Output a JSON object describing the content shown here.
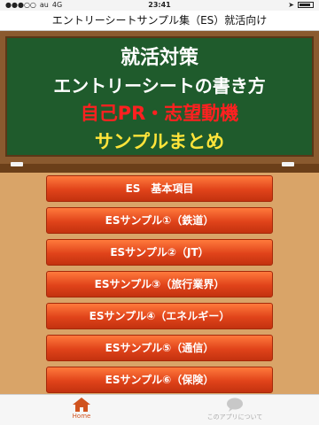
{
  "status": {
    "carrier": "au",
    "network": "4G",
    "time": "23:41"
  },
  "app": {
    "title": "エントリーシートサンプル集（ES）就活向け"
  },
  "board": {
    "line1": "就活対策",
    "line2": "エントリーシートの書き方",
    "line3": "自己PR・志望動機",
    "line4": "サンプルまとめ"
  },
  "menu": {
    "items": [
      "ES　基本項目",
      "ESサンプル①（鉄道）",
      "ESサンプル②（JT）",
      "ESサンプル③（旅行業界）",
      "ESサンプル④（エネルギー）",
      "ESサンプル⑤（通信）",
      "ESサンプル⑥（保険）"
    ]
  },
  "tabbar": {
    "home": "Home",
    "about": "このアプリについて"
  }
}
